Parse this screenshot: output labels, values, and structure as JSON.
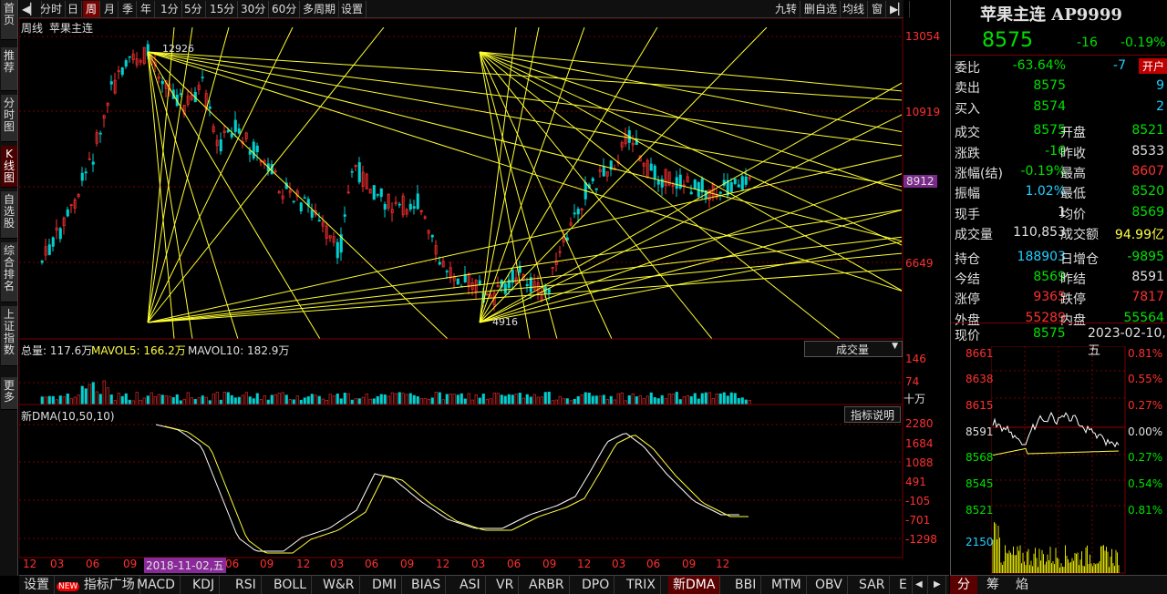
{
  "sidebar": {
    "items": [
      {
        "label": "首页"
      },
      {
        "label": "推荐"
      },
      {
        "label": "分时图"
      },
      {
        "label": "K线图"
      },
      {
        "label": "自选股"
      },
      {
        "label": "综合排名"
      },
      {
        "label": "上证指数"
      },
      {
        "label": "更多"
      }
    ]
  },
  "toolbar": {
    "periods": [
      "分时",
      "日",
      "周",
      "月",
      "季",
      "年",
      "1分",
      "5分",
      "15分",
      "30分",
      "60分",
      "多周期",
      "设置"
    ],
    "active_period": "周",
    "right": [
      "九转",
      "删自选",
      "均线",
      "窗"
    ]
  },
  "chart": {
    "period_label": "周线",
    "instrument": "苹果主连",
    "price_ticks": [
      "13054",
      "10919",
      "8912",
      "6649"
    ],
    "current_price_tag": "8912",
    "high_annotation": "12926",
    "low_annotation": "4916",
    "volume_legend": {
      "total": "总量: 117.6万",
      "mavol5": "MAVOL5: 166.2万",
      "mavol10": "MAVOL10: 182.9万",
      "dropdown": "成交量"
    },
    "volume_ticks": [
      "146",
      "74",
      "十万"
    ],
    "indicator_name": "新DMA(10,50,10)",
    "indicator_help": "指标说明",
    "indicator_ticks": [
      "2280",
      "1684",
      "1088",
      "491",
      "-105",
      "-701",
      "-1298"
    ],
    "x_ticks": [
      "12",
      "03",
      "06",
      "09",
      "2018-11-02,五",
      "06",
      "09",
      "12",
      "03",
      "06",
      "09",
      "12",
      "03",
      "06",
      "09",
      "12",
      "03",
      "06",
      "09",
      "12"
    ]
  },
  "bottom_tabs": {
    "items": [
      "设置",
      "指标广场",
      "MACD",
      "KDJ",
      "RSI",
      "BOLL",
      "W&R",
      "DMI",
      "BIAS",
      "ASI",
      "VR",
      "ARBR",
      "DPO",
      "TRIX",
      "新DMA",
      "BBI",
      "MTM",
      "OBV",
      "SAR",
      "E"
    ],
    "new_badge": "NEW",
    "active": "新DMA"
  },
  "quote": {
    "title": "苹果主连 AP9999",
    "price": "8575",
    "change": "-16",
    "change_pct": "-0.19%",
    "rows": [
      {
        "l1": "委比",
        "v1": "-63.64%",
        "l2": "",
        "v2": "-7",
        "badge": "开户"
      },
      {
        "l1": "卖出",
        "v1": "8575",
        "l2": "",
        "v2": "9"
      },
      {
        "l1": "买入",
        "v1": "8574",
        "l2": "",
        "v2": "2"
      },
      {
        "l1": "成交",
        "v1": "8575",
        "l2": "开盘",
        "v2": "8521"
      },
      {
        "l1": "涨跌",
        "v1": "-16",
        "l2": "昨收",
        "v2": "8533"
      },
      {
        "l1": "涨幅(结)",
        "v1": "-0.19%",
        "l2": "最高",
        "v2": "8607"
      },
      {
        "l1": "振幅",
        "v1": "1.02%",
        "l2": "最低",
        "v2": "8520"
      },
      {
        "l1": "现手",
        "v1": "1",
        "l2": "均价",
        "v2": "8569"
      },
      {
        "l1": "成交量",
        "v1": "110,853",
        "l2": "成交额",
        "v2": "94.99亿"
      },
      {
        "l1": "持仓",
        "v1": "188903",
        "l2": "日增仓",
        "v2": "-9895"
      },
      {
        "l1": "今结",
        "v1": "8569",
        "l2": "昨结",
        "v2": "8591"
      },
      {
        "l1": "涨停",
        "v1": "9365",
        "l2": "跌停",
        "v2": "7817"
      },
      {
        "l1": "外盘",
        "v1": "55289",
        "l2": "内盘",
        "v2": "55564"
      }
    ],
    "now_label": "现价",
    "now_value": "8575",
    "date": "2023-02-10,五",
    "mini_left": [
      "8661",
      "8638",
      "8615",
      "8591",
      "8568",
      "8545",
      "8521",
      "2150"
    ],
    "mini_right": [
      "0.81%",
      "0.55%",
      "0.27%",
      "0.00%",
      "0.27%",
      "0.54%",
      "0.81%"
    ],
    "tabs": [
      "分",
      "筹",
      "焰"
    ]
  }
}
